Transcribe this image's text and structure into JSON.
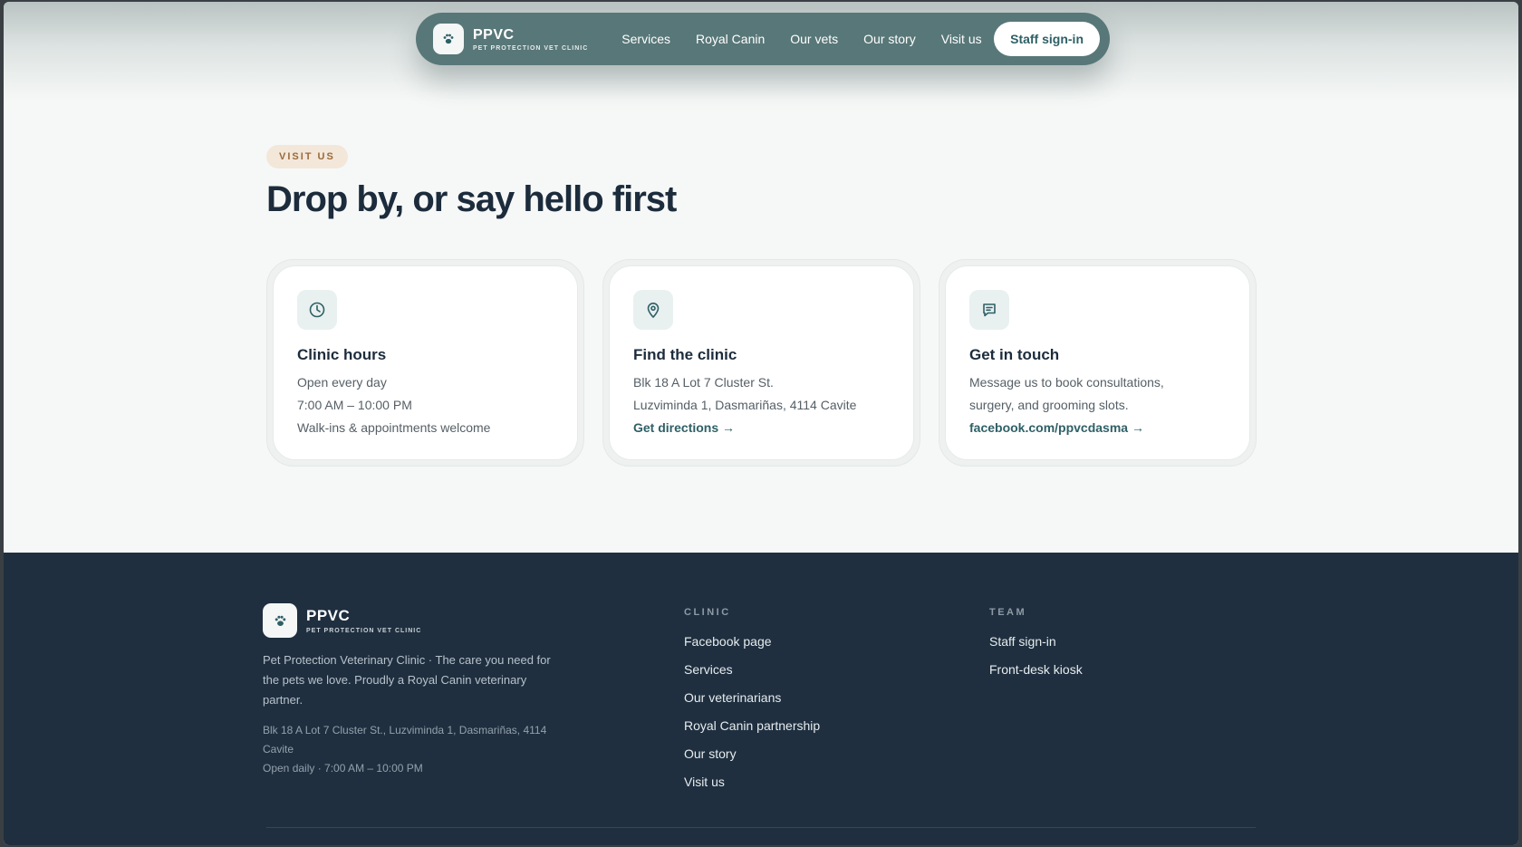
{
  "nav": {
    "brand_name": "PPVC",
    "brand_sub": "PET PROTECTION VET CLINIC",
    "links": [
      "Services",
      "Royal Canin",
      "Our vets",
      "Our story",
      "Visit us"
    ],
    "signin_label": "Staff sign-in"
  },
  "hero": {
    "eyebrow": "VISIT US",
    "title": "Drop by, or say hello first"
  },
  "cards": [
    {
      "icon": "clock-icon",
      "title": "Clinic hours",
      "lines": [
        "Open every day",
        "7:00 AM – 10:00 PM",
        "Walk-ins & appointments welcome"
      ],
      "link": ""
    },
    {
      "icon": "map-pin-icon",
      "title": "Find the clinic",
      "lines": [
        "Blk 18 A Lot 7 Cluster St.",
        "Luzviminda 1, Dasmariñas, 4114 Cavite"
      ],
      "link": "Get directions →"
    },
    {
      "icon": "chat-icon",
      "title": "Get in touch",
      "lines": [
        "Message us to book consultations,",
        "surgery, and grooming slots."
      ],
      "link": "facebook.com/ppvcdasma →"
    }
  ],
  "footer": {
    "brand_name": "PPVC",
    "brand_sub": "PET PROTECTION VET CLINIC",
    "description": "Pet Protection Veterinary Clinic · The care you need for the pets we love. Proudly a Royal Canin veterinary partner.",
    "address": "Blk 18 A Lot 7 Cluster St., Luzviminda 1, Dasmariñas, 4114 Cavite",
    "hours": "Open daily · 7:00 AM – 10:00 PM",
    "clinic": {
      "heading": "CLINIC",
      "links": [
        "Facebook page",
        "Services",
        "Our veterinarians",
        "Royal Canin partnership",
        "Our story",
        "Visit us"
      ]
    },
    "team": {
      "heading": "TEAM",
      "links": [
        "Staff sign-in",
        "Front-desk kiosk"
      ]
    }
  },
  "colors": {
    "nav_bg": "#587778",
    "accent": "#2e6066",
    "footer_bg": "#1f2f3f",
    "heading": "#1c2c3c"
  }
}
